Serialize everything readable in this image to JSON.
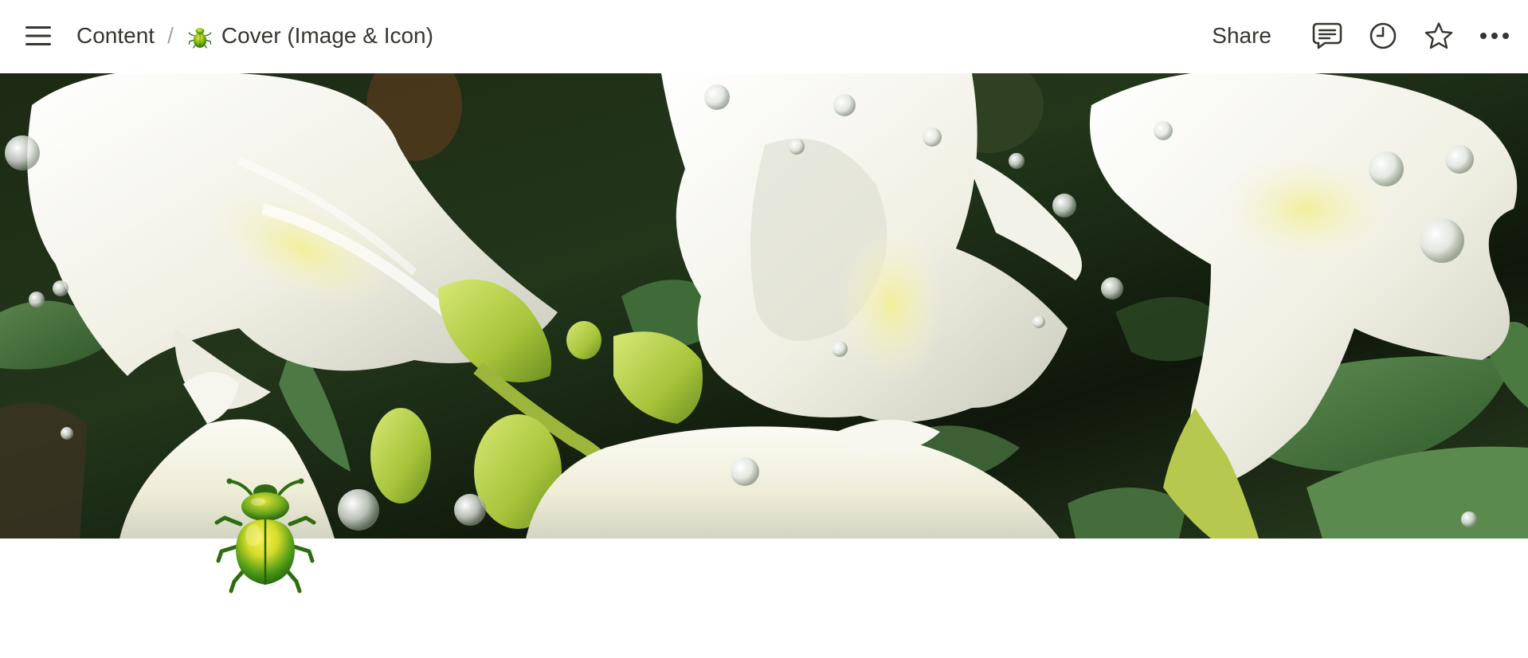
{
  "topbar": {
    "menu_icon": "hamburger-menu-icon",
    "breadcrumb": {
      "parent": "Content",
      "separator": "/",
      "page_title": "Cover (Image & Icon)",
      "page_icon": "beetle-emoji-icon"
    },
    "actions": {
      "share_label": "Share",
      "icons": [
        "comment-icon",
        "history-clock-icon",
        "star-icon",
        "more-horizontal-icon"
      ]
    }
  },
  "cover": {
    "image": "white-flowers-with-water-droplets-photo"
  },
  "page": {
    "icon": "beetle-emoji-icon"
  },
  "colors": {
    "text": "#37352f",
    "muted": "#a8a6a2",
    "background": "#ffffff"
  }
}
